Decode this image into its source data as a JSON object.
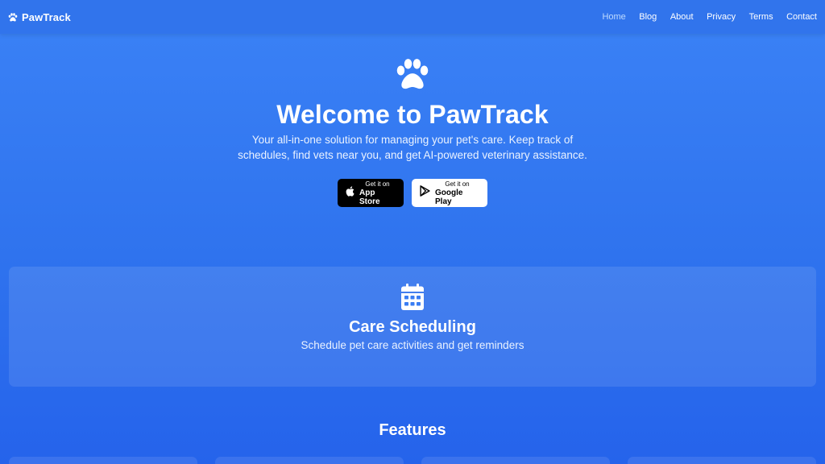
{
  "nav": {
    "brand": "PawTrack",
    "links": [
      {
        "label": "Home",
        "active": true
      },
      {
        "label": "Blog",
        "active": false
      },
      {
        "label": "About",
        "active": false
      },
      {
        "label": "Privacy",
        "active": false
      },
      {
        "label": "Terms",
        "active": false
      },
      {
        "label": "Contact",
        "active": false
      }
    ]
  },
  "hero": {
    "title": "Welcome to PawTrack",
    "subtitle": "Your all-in-one solution for managing your pet's care. Keep track of schedules, find vets near you, and get AI-powered veterinary assistance.",
    "app_store": {
      "small": "Get it on",
      "big": "App Store"
    },
    "google_play": {
      "small": "Get it on",
      "big": "Google Play"
    }
  },
  "feature": {
    "title": "Care Scheduling",
    "description": "Schedule pet care activities and get reminders"
  },
  "features_section": {
    "heading": "Features"
  },
  "icons": {
    "brand": "paw-icon",
    "hero": "paw-icon",
    "feature": "calendar-icon",
    "app_store": "apple-icon",
    "google_play": "play-store-icon"
  },
  "colors": {
    "background_top": "#3b82f6",
    "background_bottom": "#2563eb",
    "nav_active": "#bfdbfe",
    "app_store_bg": "#000000",
    "google_play_bg": "#ffffff"
  }
}
